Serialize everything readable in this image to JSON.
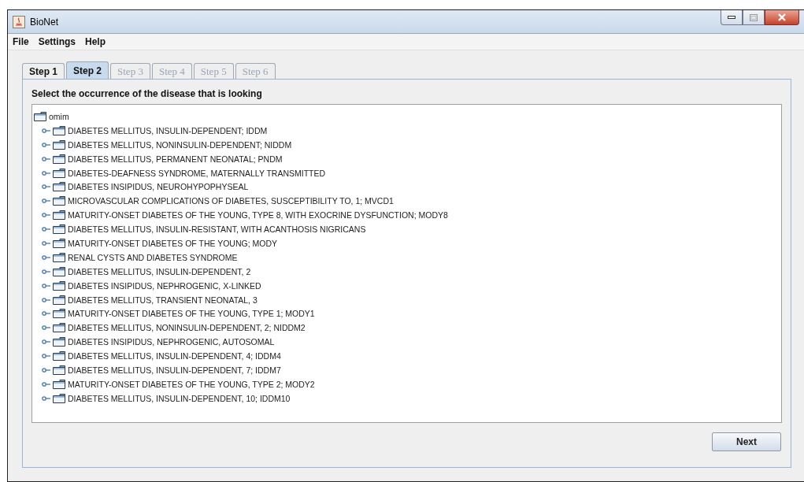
{
  "window": {
    "title": "BioNet"
  },
  "menu": [
    "File",
    "Settings",
    "Help"
  ],
  "tabs": [
    {
      "label": "Step 1",
      "selected": false,
      "disabled": false
    },
    {
      "label": "Step 2",
      "selected": true,
      "disabled": false
    },
    {
      "label": "Step 3",
      "selected": false,
      "disabled": true
    },
    {
      "label": "Step 4",
      "selected": false,
      "disabled": true
    },
    {
      "label": "Step 5",
      "selected": false,
      "disabled": true
    },
    {
      "label": "Step 6",
      "selected": false,
      "disabled": true
    }
  ],
  "instruction": "Select the occurrence of the disease that is looking",
  "tree": {
    "label": "omim",
    "children": [
      {
        "label": "DIABETES MELLITUS, INSULIN-DEPENDENT; IDDM",
        "expanded": false
      },
      {
        "label": "DIABETES MELLITUS, NONINSULIN-DEPENDENT; NIDDM",
        "expanded": false
      },
      {
        "label": "DIABETES MELLITUS, PERMANENT NEONATAL; PNDM",
        "expanded": false
      },
      {
        "label": "DIABETES-DEAFNESS SYNDROME, MATERNALLY TRANSMITTED",
        "expanded": false
      },
      {
        "label": "DIABETES INSIPIDUS, NEUROHYPOPHYSEAL",
        "expanded": false
      },
      {
        "label": "MICROVASCULAR COMPLICATIONS OF DIABETES, SUSCEPTIBILITY TO, 1; MVCD1",
        "expanded": false
      },
      {
        "label": "MATURITY-ONSET DIABETES OF THE YOUNG, TYPE 8, WITH EXOCRINE DYSFUNCTION; MODY8",
        "expanded": false
      },
      {
        "label": "DIABETES MELLITUS, INSULIN-RESISTANT, WITH ACANTHOSIS NIGRICANS",
        "expanded": false
      },
      {
        "label": "MATURITY-ONSET DIABETES OF THE YOUNG; MODY",
        "expanded": false
      },
      {
        "label": "RENAL CYSTS AND DIABETES SYNDROME",
        "expanded": false
      },
      {
        "label": "DIABETES MELLITUS, INSULIN-DEPENDENT, 2",
        "expanded": false
      },
      {
        "label": "DIABETES INSIPIDUS, NEPHROGENIC, X-LINKED",
        "expanded": false
      },
      {
        "label": "DIABETES MELLITUS, TRANSIENT NEONATAL, 3",
        "expanded": false
      },
      {
        "label": "MATURITY-ONSET DIABETES OF THE YOUNG, TYPE 1; MODY1",
        "expanded": false
      },
      {
        "label": "DIABETES MELLITUS, NONINSULIN-DEPENDENT, 2; NIDDM2",
        "expanded": false
      },
      {
        "label": "DIABETES INSIPIDUS, NEPHROGENIC, AUTOSOMAL",
        "expanded": false
      },
      {
        "label": "DIABETES MELLITUS, INSULIN-DEPENDENT, 4; IDDM4",
        "expanded": false
      },
      {
        "label": "DIABETES MELLITUS, INSULIN-DEPENDENT, 7; IDDM7",
        "expanded": false
      },
      {
        "label": "MATURITY-ONSET DIABETES OF THE YOUNG, TYPE 2; MODY2",
        "expanded": false
      },
      {
        "label": "DIABETES MELLITUS, INSULIN-DEPENDENT, 10; IDDM10",
        "expanded": false
      }
    ]
  },
  "buttons": [
    "Next"
  ]
}
